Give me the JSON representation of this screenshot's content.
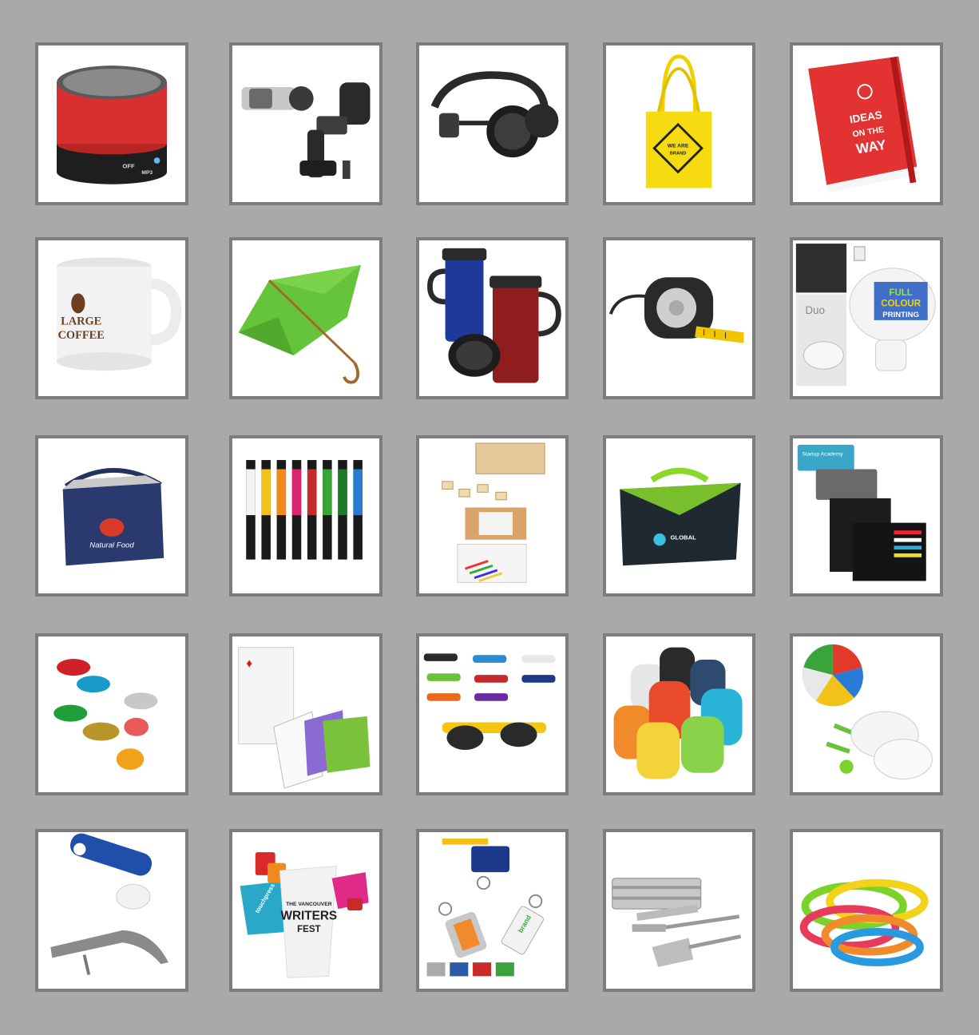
{
  "products": [
    {
      "id": "bluetooth-speaker",
      "controls": {
        "off": "OFF",
        "mp3": "MP3"
      }
    },
    {
      "id": "car-phone-holder"
    },
    {
      "id": "foldable-headphones"
    },
    {
      "id": "yellow-tote-bag",
      "print": {
        "line1": "WE ARE",
        "line2": "BRAND"
      }
    },
    {
      "id": "red-notebook",
      "print": {
        "line1": "IDEAS",
        "line2": "ON THE",
        "line3": "WAY"
      }
    },
    {
      "id": "white-mug",
      "print": {
        "line1": "LARGE",
        "line2": "COFFEE"
      }
    },
    {
      "id": "green-umbrella"
    },
    {
      "id": "travel-mugs"
    },
    {
      "id": "tape-measure"
    },
    {
      "id": "usb-car-charger",
      "print": {
        "duo": "Duo",
        "line1": "FULL",
        "line2": "COLOUR",
        "line3": "PRINTING"
      }
    },
    {
      "id": "cooler-bag",
      "print": {
        "brand": "Natural Food"
      }
    },
    {
      "id": "ballpoint-pens"
    },
    {
      "id": "kids-games-set"
    },
    {
      "id": "laptop-bag",
      "print": {
        "brand": "GLOBAL"
      }
    },
    {
      "id": "card-wallet",
      "print": {
        "header": "Startup Academy"
      }
    },
    {
      "id": "wrapped-candies"
    },
    {
      "id": "playing-cards"
    },
    {
      "id": "sunglasses"
    },
    {
      "id": "backpacks"
    },
    {
      "id": "beach-ball-paddles"
    },
    {
      "id": "bottle-opener-corkscrew"
    },
    {
      "id": "printed-cups",
      "print": {
        "top": "THE VANCOUVER",
        "mid": "WRITERS",
        "bot": "FEST",
        "side": "touchpress"
      }
    },
    {
      "id": "keychains",
      "print": {
        "tag": "brand"
      }
    },
    {
      "id": "bbq-set"
    },
    {
      "id": "silicone-wristbands"
    }
  ],
  "colors": {
    "background": "#a9a9a9",
    "frame": "#7d7d7d",
    "tile": "#ffffff"
  }
}
